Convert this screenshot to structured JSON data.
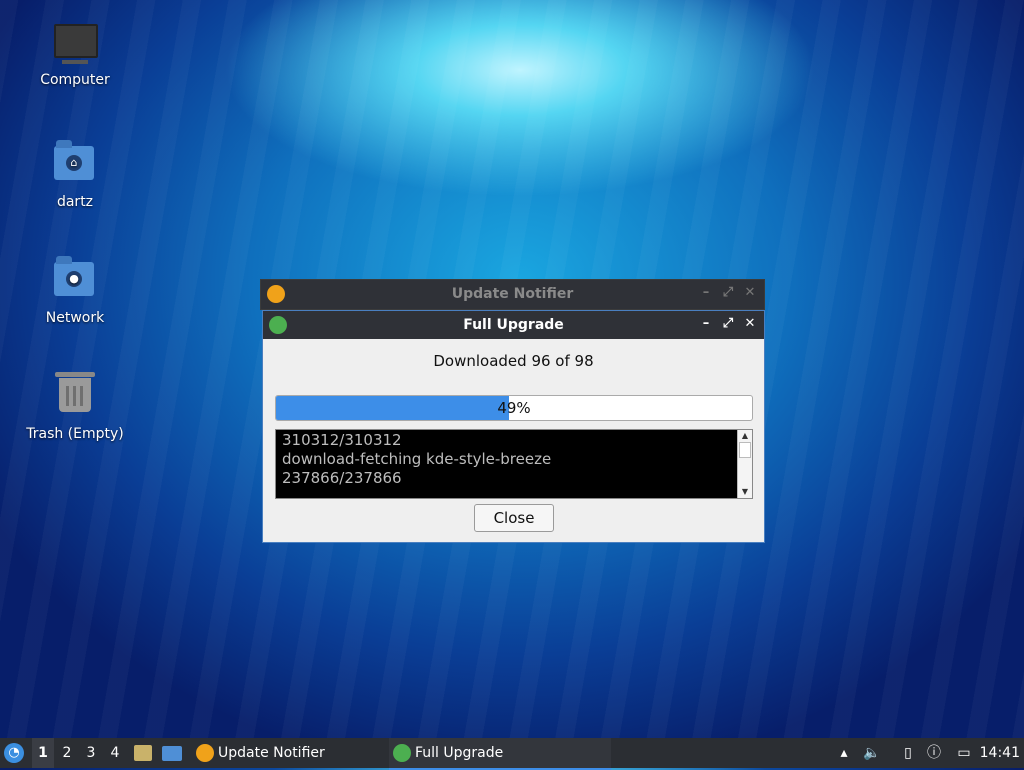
{
  "desktop": {
    "icons": [
      {
        "label": "Computer"
      },
      {
        "label": "dartz"
      },
      {
        "label": "Network"
      },
      {
        "label": "Trash (Empty)"
      }
    ]
  },
  "bg_window": {
    "title": "Update Notifier"
  },
  "dialog": {
    "title": "Full Upgrade",
    "status": "Downloaded 96 of 98",
    "progress_percent": 49,
    "progress_label": "49%",
    "console_lines": [
      "310312/310312",
      "download-fetching kde-style-breeze",
      "237866/237866"
    ],
    "close_label": "Close"
  },
  "taskbar": {
    "workspaces": [
      "1",
      "2",
      "3",
      "4"
    ],
    "active_workspace": "1",
    "tasks": [
      {
        "label": "Update Notifier",
        "icon": "update-notifier-icon"
      },
      {
        "label": "Full Upgrade",
        "icon": "gear-icon"
      }
    ],
    "clock": "14:41"
  },
  "colors": {
    "accent": "#3d8ee8",
    "titlebar": "#2f3137",
    "taskbar": "#2b2e33"
  }
}
